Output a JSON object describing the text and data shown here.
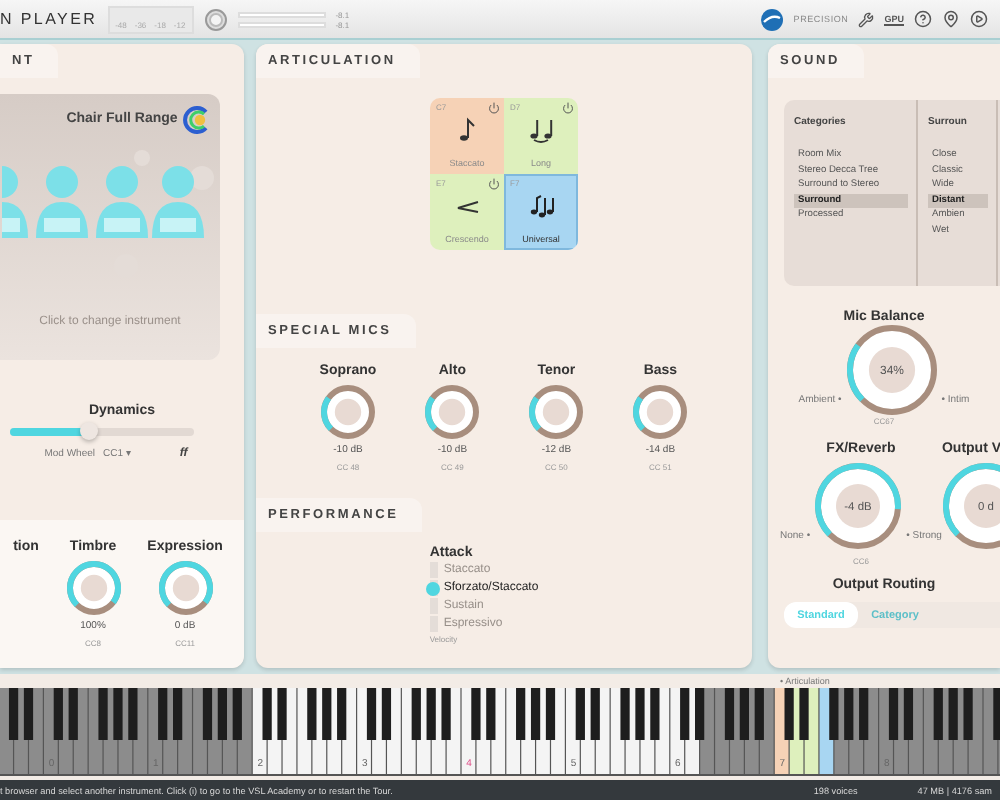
{
  "topbar": {
    "title": "N PLAYER",
    "meter_ticks": [
      "-48",
      "-36",
      "-18",
      "-12"
    ],
    "peak_readings": [
      "-8.1",
      "-8.1"
    ],
    "brand": "PRECISION",
    "gpu_label": "GPU"
  },
  "instrument_panel": {
    "tab": "NT",
    "instrument": "Chair Full Range",
    "hint": "Click to change instrument",
    "dynamics": {
      "label": "Dynamics",
      "level": 0.42,
      "controller": "Mod Wheel",
      "cc": "CC1 ▾",
      "marking": "ff"
    },
    "knobs": [
      {
        "label": "tion"
      },
      {
        "label": "Timbre",
        "value": "100%",
        "cc": "CC8"
      },
      {
        "label": "Expression",
        "value": "0 dB",
        "cc": "CC11"
      }
    ]
  },
  "articulation": {
    "title": "ARTICULATION",
    "cells": [
      {
        "key": "C7",
        "label": "Staccato",
        "kind": "staccato",
        "color": "#f6d2b6",
        "selected": false,
        "power_button": true
      },
      {
        "key": "D7",
        "label": "Long",
        "kind": "long",
        "color": "#def0bd",
        "selected": false,
        "power_button": true
      },
      {
        "key": "E7",
        "label": "Crescendo",
        "kind": "crescendo",
        "color": "#def0bd",
        "selected": false,
        "power_button": true
      },
      {
        "key": "F7",
        "label": "Universal",
        "kind": "universal",
        "color": "#a8d6f2",
        "selected": true,
        "power_button": false
      }
    ]
  },
  "special_mics": {
    "title": "SPECIAL MICS",
    "mics": [
      {
        "label": "Soprano",
        "value": "-10 dB",
        "cc": "CC 48"
      },
      {
        "label": "Alto",
        "value": "-10 dB",
        "cc": "CC 49"
      },
      {
        "label": "Tenor",
        "value": "-12 dB",
        "cc": "CC 50"
      },
      {
        "label": "Bass",
        "value": "-14 dB",
        "cc": "CC 51"
      }
    ]
  },
  "performance": {
    "title": "PERFORMANCE",
    "attack": {
      "label": "Attack",
      "options": [
        {
          "label": "Staccato",
          "selected": false
        },
        {
          "label": "Sforzato/Staccato",
          "selected": true
        },
        {
          "label": "Sustain",
          "selected": false
        },
        {
          "label": "Espressivo",
          "selected": false
        }
      ],
      "source": "Velocity"
    }
  },
  "sound": {
    "title": "SOUND",
    "categories": {
      "heading": "Categories",
      "items": [
        {
          "label": "Room Mix",
          "selected": false
        },
        {
          "label": "Stereo Decca Tree",
          "selected": false
        },
        {
          "label": "Surround to Stereo",
          "selected": false
        },
        {
          "label": "Surround",
          "selected": true
        },
        {
          "label": "Processed",
          "selected": false
        }
      ]
    },
    "positions": {
      "heading": "Surroun",
      "items": [
        {
          "label": "Close",
          "selected": false
        },
        {
          "label": "Classic",
          "selected": false
        },
        {
          "label": "Wide",
          "selected": false
        },
        {
          "label": "Distant",
          "selected": true
        },
        {
          "label": "Ambien",
          "selected": false
        },
        {
          "label": "Wet",
          "selected": false
        }
      ]
    },
    "mic_balance": {
      "label": "Mic Balance",
      "value": "34%",
      "left": "Ambient •",
      "right": "• Intim",
      "cc": "CC67"
    },
    "fx_reverb": {
      "label": "FX/Reverb",
      "value": "-4 dB",
      "left": "None •",
      "right": "• Strong",
      "cc": "CC6"
    },
    "output_volume": {
      "label": "Output V",
      "value": "0 d"
    },
    "output_routing": {
      "label": "Output Routing",
      "tabs": [
        {
          "label": "Standard",
          "selected": true
        },
        {
          "label": "Category",
          "selected": false
        }
      ]
    }
  },
  "keyboard": {
    "label": "• Articulation",
    "octaves": [
      {
        "label": "0",
        "highlighted": false
      },
      {
        "label": "1",
        "highlighted": false
      },
      {
        "label": "2",
        "highlighted": false
      },
      {
        "label": "3",
        "highlighted": false
      },
      {
        "label": "4",
        "highlighted": true
      },
      {
        "label": "5",
        "highlighted": false
      },
      {
        "label": "6",
        "highlighted": false
      },
      {
        "label": "7",
        "highlighted": false
      },
      {
        "label": "8",
        "highlighted": false
      }
    ]
  },
  "status_bar": {
    "message": "t browser and select another instrument. Click (i) to go to the VSL Academy or to restart the Tour.",
    "voices": "198 voices",
    "memory": "47 MB | 4176 sam"
  }
}
